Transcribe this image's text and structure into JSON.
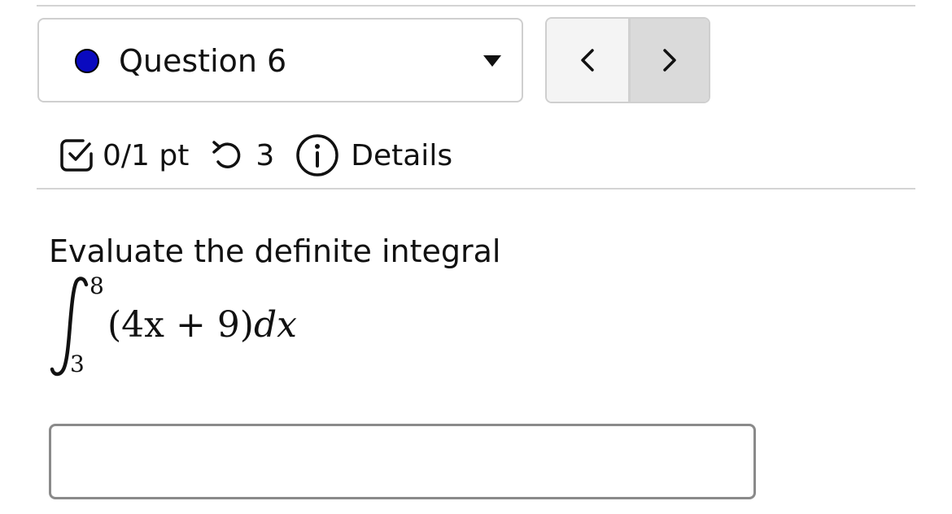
{
  "question_nav": {
    "selected_question": "Question 6",
    "status_color": "#0a0abf",
    "prev_icon": "chevron-left-icon",
    "next_icon": "chevron-right-icon"
  },
  "meta": {
    "points": "0/1 pt",
    "retries": "3",
    "details_label": "Details"
  },
  "question": {
    "prompt": "Evaluate the definite integral",
    "integral": {
      "lower_limit": "3",
      "upper_limit": "8",
      "integrand": "(4x + 9)",
      "differential": "dx"
    }
  },
  "answer": {
    "value": "",
    "placeholder": ""
  }
}
